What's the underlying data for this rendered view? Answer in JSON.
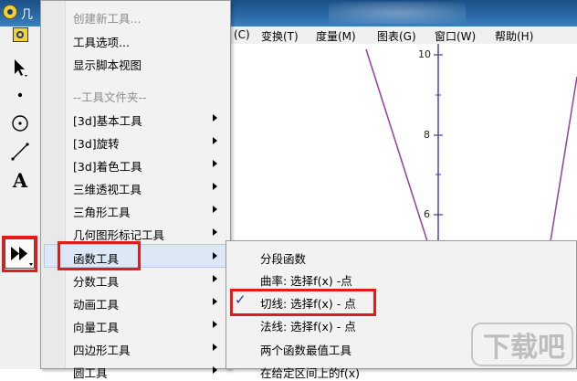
{
  "window": {
    "title_fragment": "几"
  },
  "menubar": {
    "items": [
      {
        "label": "(C)"
      },
      {
        "label": "变换(T)"
      },
      {
        "label": "度量(M)"
      },
      {
        "label": "图表(G)"
      },
      {
        "label": "窗口(W)"
      },
      {
        "label": "帮助(H)"
      }
    ]
  },
  "toolbox": {
    "tools": [
      {
        "name": "arrow-select-tool"
      },
      {
        "name": "point-tool"
      },
      {
        "name": "compass-tool"
      },
      {
        "name": "straightedge-tool"
      },
      {
        "name": "text-tool",
        "glyph": "A"
      },
      {
        "name": "custom-tool"
      }
    ]
  },
  "tools_menu": {
    "items": [
      {
        "label": "创建新工具...",
        "disabled": true
      },
      {
        "label": "工具选项..."
      },
      {
        "label": "显示脚本视图"
      },
      {
        "label": "--工具文件夹--",
        "disabled": true
      },
      {
        "label": "[3d]基本工具",
        "submenu": true
      },
      {
        "label": "[3d]旋转",
        "submenu": true
      },
      {
        "label": "[3d]着色工具",
        "submenu": true
      },
      {
        "label": "三维透视工具",
        "submenu": true
      },
      {
        "label": "三角形工具",
        "submenu": true
      },
      {
        "label": "几何图形标记工具",
        "submenu": true
      },
      {
        "label": "函数工具",
        "submenu": true,
        "highlighted": true
      },
      {
        "label": "分数工具",
        "submenu": true
      },
      {
        "label": "动画工具",
        "submenu": true
      },
      {
        "label": "向量工具",
        "submenu": true
      },
      {
        "label": "四边形工具",
        "submenu": true
      },
      {
        "label": "圆工具",
        "submenu": true
      }
    ]
  },
  "function_tools_submenu": {
    "items": [
      {
        "label": "分段函数"
      },
      {
        "label": "曲率: 选择f(x) -点"
      },
      {
        "label": "切线: 选择f(x) - 点",
        "checked": true
      },
      {
        "label": "法线: 选择f(x) - 点"
      },
      {
        "label": "两个函数最值工具"
      },
      {
        "label": "在给定区间上的f(x)"
      }
    ],
    "check_glyph": "✓"
  },
  "canvas": {
    "y_axis_labels": [
      "10",
      "8",
      "6"
    ],
    "curve_color": "#9a3aa0",
    "axis_color": "#3b3b9e"
  },
  "colors": {
    "highlight_red": "#e21b1b",
    "menu_hover": "#dde8f6"
  },
  "watermark": {
    "text": "下载吧"
  }
}
